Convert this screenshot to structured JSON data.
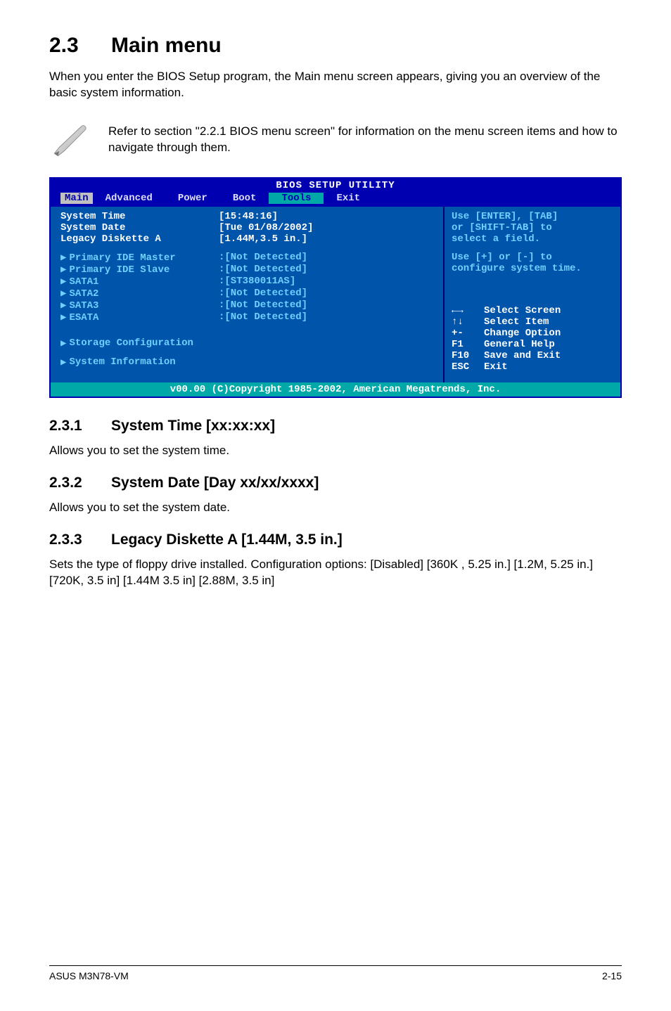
{
  "heading": {
    "num": "2.3",
    "title": "Main menu"
  },
  "intro": "When you enter the BIOS Setup program, the Main menu screen appears, giving you an overview of the basic system information.",
  "note": "Refer to section \"2.2.1 BIOS menu screen\" for information on the menu screen items and how to navigate through them.",
  "bios": {
    "title": "BIOS SETUP UTILITY",
    "menus": [
      "Main",
      "Advanced",
      "Power",
      "Boot",
      "Tools",
      "Exit"
    ],
    "rows": [
      {
        "label": "System Time",
        "value": "[15:48:16]",
        "selected": true
      },
      {
        "label": "System Date",
        "value": "[Tue 01/08/2002]",
        "selected": true
      },
      {
        "label": "Legacy Diskette A",
        "value": "[1.44M,3.5 in.]",
        "selected": true
      }
    ],
    "devices": [
      {
        "label": "Primary IDE Master",
        "value": ":[Not Detected]"
      },
      {
        "label": "Primary IDE Slave",
        "value": ":[Not Detected]"
      },
      {
        "label": "SATA1",
        "value": ":[ST380011AS]"
      },
      {
        "label": "SATA2",
        "value": ":[Not Detected]"
      },
      {
        "label": "SATA3",
        "value": ":[Not Detected]"
      },
      {
        "label": "ESATA",
        "value": ":[Not Detected]"
      }
    ],
    "submenus": [
      "Storage Configuration",
      "System Information"
    ],
    "help": {
      "line1": "Use [ENTER], [TAB]",
      "line2": "or [SHIFT-TAB] to",
      "line3": "select a field.",
      "line4": "Use [+] or [-] to",
      "line5": "configure system time."
    },
    "legend": [
      {
        "key": "←→",
        "desc": "Select Screen"
      },
      {
        "key": "↑↓",
        "desc": "Select Item"
      },
      {
        "key": "+-",
        "desc": "Change Option"
      },
      {
        "key": "F1",
        "desc": "General Help"
      },
      {
        "key": "F10",
        "desc": "Save and Exit"
      },
      {
        "key": "ESC",
        "desc": "Exit"
      }
    ],
    "footer": "v00.00 (C)Copyright 1985-2002, American Megatrends, Inc."
  },
  "sections": [
    {
      "num": "2.3.1",
      "title": "System Time [xx:xx:xx]",
      "body": "Allows you to set the system time."
    },
    {
      "num": "2.3.2",
      "title": "System Date [Day xx/xx/xxxx]",
      "body": "Allows you to set the system date."
    },
    {
      "num": "2.3.3",
      "title": "Legacy Diskette A [1.44M, 3.5 in.]",
      "body": "Sets the type of floppy drive installed. Configuration options: [Disabled] [360K , 5.25 in.] [1.2M, 5.25 in.] [720K, 3.5 in] [1.44M 3.5 in] [2.88M, 3.5 in]"
    }
  ],
  "footer": {
    "left": "ASUS M3N78-VM",
    "right": "2-15"
  }
}
